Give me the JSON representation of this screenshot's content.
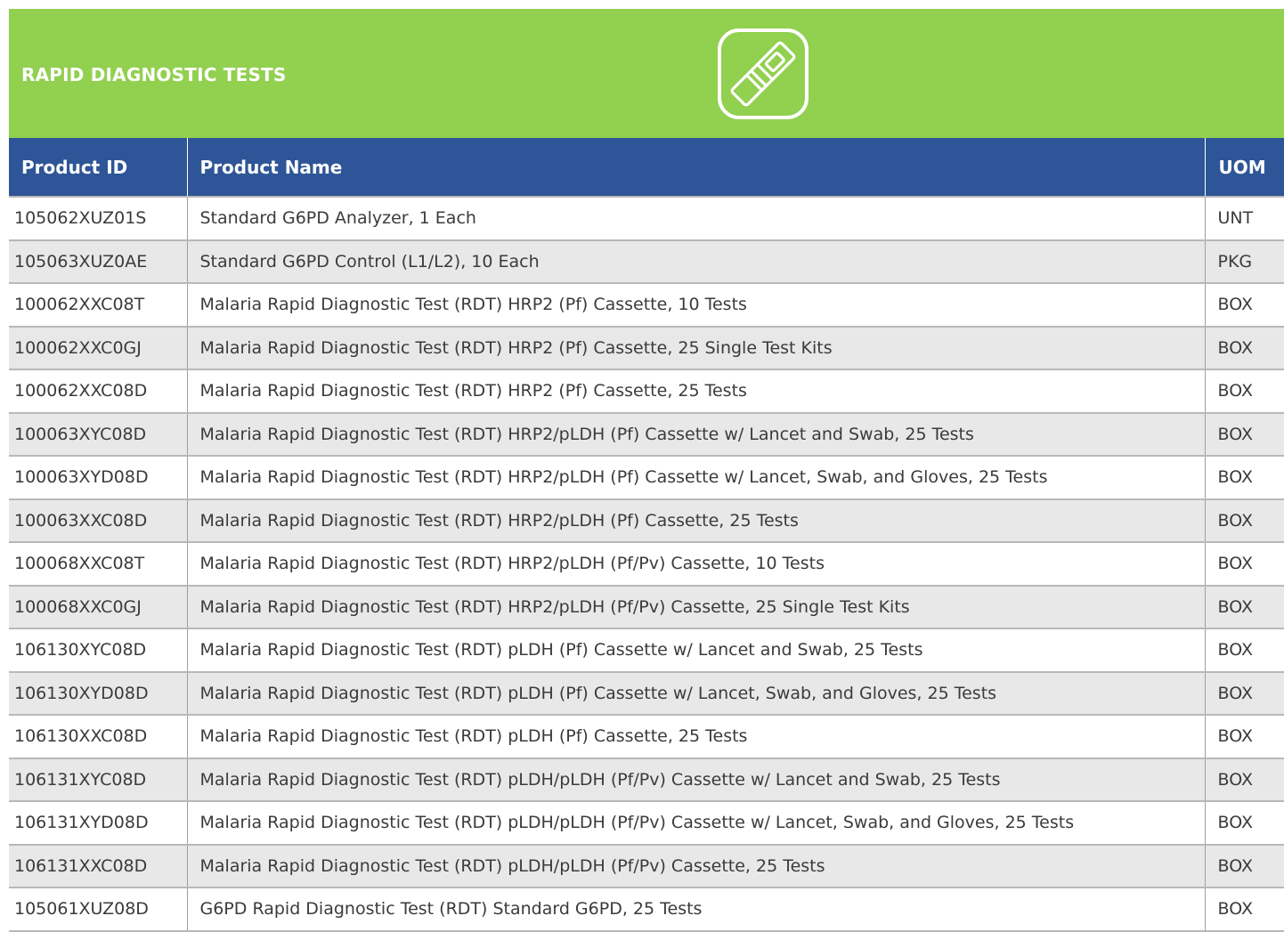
{
  "section": {
    "title": "RAPID DIAGNOSTIC TESTS",
    "icon": "rapid-test-cassette-icon",
    "banner_color": "#92d050",
    "header_color": "#2e5597"
  },
  "table": {
    "headers": {
      "id": "Product ID",
      "name": "Product Name",
      "uom": "UOM"
    },
    "rows": [
      {
        "id": "105062XUZ01S",
        "name": "Standard G6PD Analyzer, 1 Each",
        "uom": "UNT"
      },
      {
        "id": "105063XUZ0AE",
        "name": "Standard G6PD Control (L1/L2), 10 Each",
        "uom": "PKG"
      },
      {
        "id": "100062XXC08T",
        "name": "Malaria Rapid Diagnostic Test (RDT) HRP2 (Pf) Cassette, 10 Tests",
        "uom": "BOX"
      },
      {
        "id": "100062XXC0GJ",
        "name": "Malaria Rapid Diagnostic Test (RDT) HRP2 (Pf) Cassette, 25 Single Test Kits",
        "uom": "BOX"
      },
      {
        "id": "100062XXC08D",
        "name": "Malaria Rapid Diagnostic Test (RDT) HRP2 (Pf) Cassette, 25 Tests",
        "uom": "BOX"
      },
      {
        "id": "100063XYC08D",
        "name": "Malaria Rapid Diagnostic Test (RDT) HRP2/pLDH (Pf) Cassette w/ Lancet and Swab, 25 Tests",
        "uom": "BOX"
      },
      {
        "id": "100063XYD08D",
        "name": "Malaria Rapid Diagnostic Test (RDT) HRP2/pLDH (Pf) Cassette w/ Lancet, Swab, and Gloves, 25 Tests",
        "uom": "BOX"
      },
      {
        "id": "100063XXC08D",
        "name": "Malaria Rapid Diagnostic Test (RDT) HRP2/pLDH (Pf) Cassette, 25 Tests",
        "uom": "BOX"
      },
      {
        "id": "100068XXC08T",
        "name": "Malaria Rapid Diagnostic Test (RDT) HRP2/pLDH (Pf/Pv) Cassette, 10 Tests",
        "uom": "BOX"
      },
      {
        "id": "100068XXC0GJ",
        "name": "Malaria Rapid Diagnostic Test (RDT) HRP2/pLDH (Pf/Pv) Cassette, 25 Single Test Kits",
        "uom": "BOX"
      },
      {
        "id": "106130XYC08D",
        "name": "Malaria Rapid Diagnostic Test (RDT) pLDH (Pf) Cassette w/ Lancet and Swab, 25 Tests",
        "uom": "BOX"
      },
      {
        "id": "106130XYD08D",
        "name": "Malaria Rapid Diagnostic Test (RDT) pLDH (Pf) Cassette w/ Lancet, Swab, and Gloves, 25 Tests",
        "uom": "BOX"
      },
      {
        "id": "106130XXC08D",
        "name": "Malaria Rapid Diagnostic Test (RDT) pLDH (Pf) Cassette, 25 Tests",
        "uom": "BOX"
      },
      {
        "id": "106131XYC08D",
        "name": "Malaria Rapid Diagnostic Test (RDT) pLDH/pLDH (Pf/Pv) Cassette w/ Lancet and Swab, 25 Tests",
        "uom": "BOX"
      },
      {
        "id": "106131XYD08D",
        "name": "Malaria Rapid Diagnostic Test (RDT) pLDH/pLDH (Pf/Pv) Cassette w/ Lancet, Swab, and Gloves, 25 Tests",
        "uom": "BOX"
      },
      {
        "id": "106131XXC08D",
        "name": "Malaria Rapid Diagnostic Test (RDT) pLDH/pLDH (Pf/Pv) Cassette, 25 Tests",
        "uom": "BOX"
      },
      {
        "id": "105061XUZ08D",
        "name": "G6PD Rapid Diagnostic Test (RDT) Standard G6PD, 25 Tests",
        "uom": "BOX"
      }
    ]
  }
}
